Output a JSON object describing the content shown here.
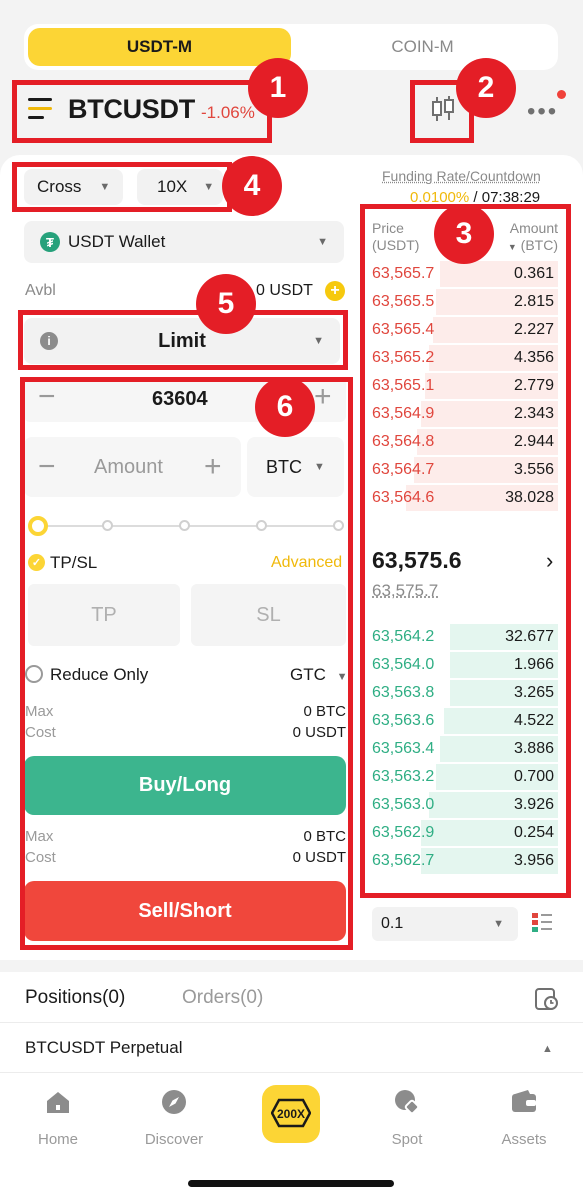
{
  "top_toggle": {
    "active": "USDT-M",
    "inactive": "COIN-M"
  },
  "header": {
    "pair": "BTCUSDT",
    "change": "-1.06%"
  },
  "margin": {
    "mode": "Cross",
    "leverage": "10X"
  },
  "funding": {
    "label": "Funding Rate/Countdown",
    "rate": "0.0100%",
    "separator": " / ",
    "countdown": "07:38:29"
  },
  "wallet": {
    "label": "USDT Wallet",
    "icon": "tether-icon"
  },
  "avbl": {
    "label": "Avbl",
    "value": "0 USDT"
  },
  "order_type": "Limit",
  "price_input": "63604",
  "amount": {
    "placeholder": "Amount",
    "unit": "BTC"
  },
  "tpsl": {
    "label": "TP/SL",
    "advanced": "Advanced",
    "tp": "TP",
    "sl": "SL"
  },
  "reduce_only": "Reduce Only",
  "tif": "GTC",
  "buy_info": {
    "max_label": "Max",
    "max_value": "0 BTC",
    "cost_label": "Cost",
    "cost_value": "0 USDT"
  },
  "sell_info": {
    "max_label": "Max",
    "max_value": "0 BTC",
    "cost_label": "Cost",
    "cost_value": "0 USDT"
  },
  "buy_label": "Buy/Long",
  "sell_label": "Sell/Short",
  "orderbook": {
    "price_header": "Price",
    "price_unit": "(USDT)",
    "amount_header": "Amount",
    "amount_unit": "(BTC)",
    "asks": [
      {
        "price": "63,565.7",
        "amount": "0.361",
        "depth": 0.62
      },
      {
        "price": "63,565.5",
        "amount": "2.815",
        "depth": 0.64
      },
      {
        "price": "63,565.4",
        "amount": "2.227",
        "depth": 0.66
      },
      {
        "price": "63,565.2",
        "amount": "4.356",
        "depth": 0.68
      },
      {
        "price": "63,565.1",
        "amount": "2.779",
        "depth": 0.7
      },
      {
        "price": "63,564.9",
        "amount": "2.343",
        "depth": 0.72
      },
      {
        "price": "63,564.8",
        "amount": "2.944",
        "depth": 0.74
      },
      {
        "price": "63,564.7",
        "amount": "3.556",
        "depth": 0.76
      },
      {
        "price": "63,564.6",
        "amount": "38.028",
        "depth": 0.8
      }
    ],
    "last_price": "63,575.6",
    "mark_price": "63,575.7",
    "bids": [
      {
        "price": "63,564.2",
        "amount": "32.677",
        "depth": 0.57
      },
      {
        "price": "63,564.0",
        "amount": "1.966",
        "depth": 0.57
      },
      {
        "price": "63,563.8",
        "amount": "3.265",
        "depth": 0.57
      },
      {
        "price": "63,563.6",
        "amount": "4.522",
        "depth": 0.6
      },
      {
        "price": "63,563.4",
        "amount": "3.886",
        "depth": 0.62
      },
      {
        "price": "63,563.2",
        "amount": "0.700",
        "depth": 0.64
      },
      {
        "price": "63,563.0",
        "amount": "3.926",
        "depth": 0.68
      },
      {
        "price": "63,562.9",
        "amount": "0.254",
        "depth": 0.72
      },
      {
        "price": "63,562.7",
        "amount": "3.956",
        "depth": 0.72
      }
    ],
    "depth_step": "0.1"
  },
  "positions": {
    "tab_positions": "Positions(0)",
    "tab_orders": "Orders(0)",
    "row": "BTCUSDT Perpetual"
  },
  "nav": {
    "home": "Home",
    "discover": "Discover",
    "center": "200X",
    "spot": "Spot",
    "assets": "Assets"
  },
  "annotations": [
    "1",
    "2",
    "3",
    "4",
    "5",
    "6"
  ],
  "colors": {
    "accent": "#fcd535",
    "buy": "#3cb58e",
    "sell": "#f0473c",
    "annotation": "#e41e26"
  }
}
